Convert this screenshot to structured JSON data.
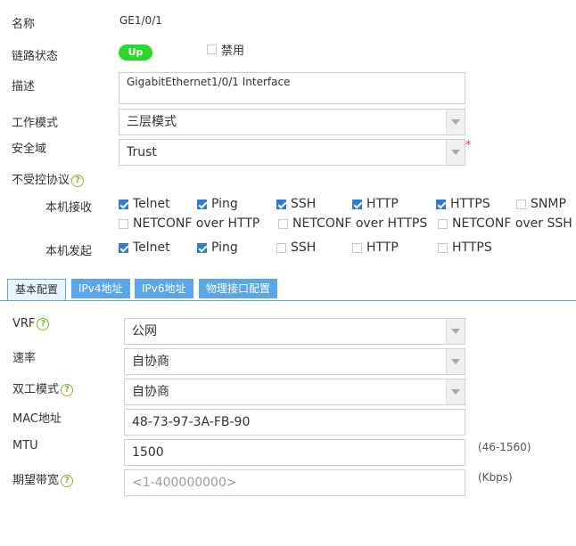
{
  "name": {
    "label": "名称",
    "value": "GE1/0/1"
  },
  "link_status": {
    "label": "链路状态",
    "badge": "Up",
    "disable_label": "禁用"
  },
  "description": {
    "label": "描述",
    "value": "GigabitEthernet1/0/1 Interface"
  },
  "work_mode": {
    "label": "工作模式",
    "value": "三层模式"
  },
  "security_zone": {
    "label": "安全域",
    "value": "Trust",
    "required": "*"
  },
  "uncontrolled_protocols": {
    "label": "不受控协议",
    "local_receive": {
      "label": "本机接收",
      "items": [
        {
          "label": "Telnet",
          "checked": true
        },
        {
          "label": "Ping",
          "checked": true
        },
        {
          "label": "SSH",
          "checked": true
        },
        {
          "label": "HTTP",
          "checked": true
        },
        {
          "label": "HTTPS",
          "checked": true
        },
        {
          "label": "SNMP",
          "checked": false
        },
        {
          "label": "NETCONF over HTTP",
          "checked": false
        },
        {
          "label": "NETCONF over HTTPS",
          "checked": false
        },
        {
          "label": "NETCONF over SSH",
          "checked": false
        }
      ]
    },
    "local_send": {
      "label": "本机发起",
      "items": [
        {
          "label": "Telnet",
          "checked": true
        },
        {
          "label": "Ping",
          "checked": true
        },
        {
          "label": "SSH",
          "checked": false
        },
        {
          "label": "HTTP",
          "checked": false
        },
        {
          "label": "HTTPS",
          "checked": false
        }
      ]
    }
  },
  "tabs": [
    "基本配置",
    "IPv4地址",
    "IPv6地址",
    "物理接口配置"
  ],
  "basic": {
    "vrf": {
      "label": "VRF",
      "value": "公网"
    },
    "speed": {
      "label": "速率",
      "value": "自协商"
    },
    "duplex": {
      "label": "双工模式",
      "value": "自协商"
    },
    "mac": {
      "label": "MAC地址",
      "value": "48-73-97-3A-FB-90"
    },
    "mtu": {
      "label": "MTU",
      "value": "1500",
      "hint": "(46-1560)"
    },
    "bandwidth": {
      "label": "期望带宽",
      "placeholder": "<1-400000000>",
      "hint": "(Kbps)"
    }
  },
  "colors": {
    "accent": "#5aa6e8",
    "up_badge": "#2bd82b",
    "checkbox": "#2c7bd6",
    "help_icon": "#7cbd2a"
  }
}
